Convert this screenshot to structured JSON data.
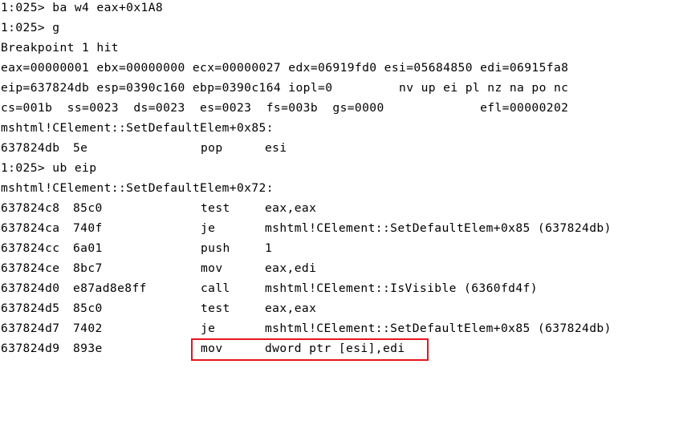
{
  "console": {
    "lines_top": [
      "1:025> ba w4 eax+0x1A8",
      "1:025> g",
      "Breakpoint 1 hit",
      "eax=00000001 ebx=00000000 ecx=00000027 edx=06919fd0 esi=05684850 edi=06915fa8",
      "eip=637824db esp=0390c160 ebp=0390c164 iopl=0         nv up ei pl nz na po nc",
      "cs=001b  ss=0023  ds=0023  es=0023  fs=003b  gs=0000             efl=00000202",
      "mshtml!CElement::SetDefaultElem+0x85:"
    ],
    "current_instr": {
      "addr": "637824db",
      "bytes": "5e",
      "mnem": "pop",
      "ops": "esi"
    },
    "lines_mid": [
      "1:025> ub eip",
      "mshtml!CElement::SetDefaultElem+0x72:"
    ],
    "disasm": [
      {
        "addr": "637824c8",
        "bytes": "85c0",
        "mnem": "test",
        "ops": "eax,eax"
      },
      {
        "addr": "637824ca",
        "bytes": "740f",
        "mnem": "je",
        "ops": "mshtml!CElement::SetDefaultElem+0x85 (637824db)"
      },
      {
        "addr": "637824cc",
        "bytes": "6a01",
        "mnem": "push",
        "ops": "1"
      },
      {
        "addr": "637824ce",
        "bytes": "8bc7",
        "mnem": "mov",
        "ops": "eax,edi"
      },
      {
        "addr": "637824d0",
        "bytes": "e87ad8e8ff",
        "mnem": "call",
        "ops": "mshtml!CElement::IsVisible (6360fd4f)"
      },
      {
        "addr": "637824d5",
        "bytes": "85c0",
        "mnem": "test",
        "ops": "eax,eax"
      },
      {
        "addr": "637824d7",
        "bytes": "7402",
        "mnem": "je",
        "ops": "mshtml!CElement::SetDefaultElem+0x85 (637824db)"
      },
      {
        "addr": "637824d9",
        "bytes": "893e",
        "mnem": "mov",
        "ops": "dword ptr [esi],edi"
      }
    ],
    "highlight_color": "#e8141c",
    "text_color": "#000000",
    "background_color": "#ffffff"
  }
}
